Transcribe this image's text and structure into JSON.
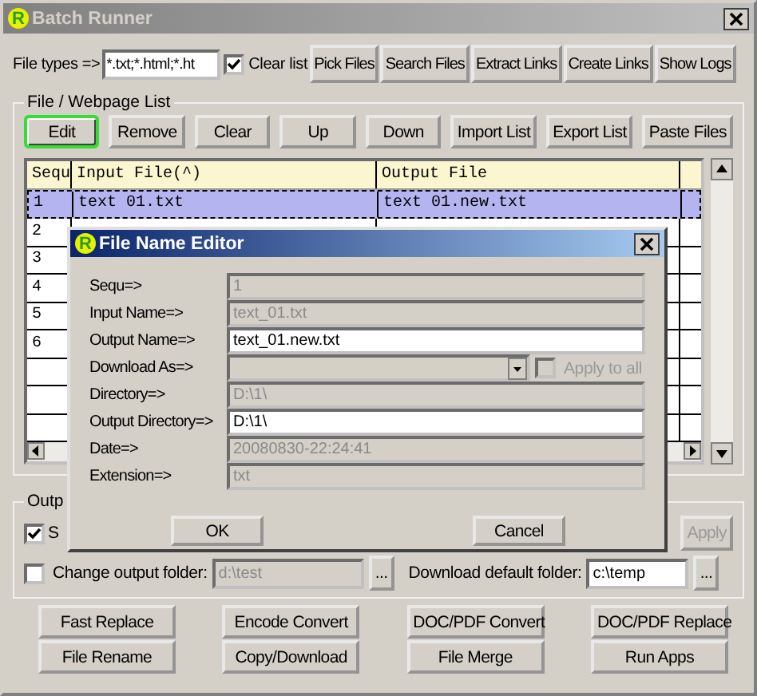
{
  "window": {
    "icon_letter": "R",
    "title": "Batch Runner"
  },
  "top_bar": {
    "file_types_label": "File types =>",
    "file_types_value": "*.txt;*.html;*.ht",
    "clear_list": {
      "label": "Clear list",
      "checked": true
    },
    "buttons": [
      "Pick Files",
      "Search Files",
      "Extract Links",
      "Create Links",
      "Show Logs"
    ]
  },
  "list_group": {
    "title": "File / Webpage List",
    "buttons": [
      {
        "label": "Edit",
        "highlighted": true
      },
      {
        "label": "Remove",
        "highlighted": false
      },
      {
        "label": "Clear",
        "highlighted": false
      },
      {
        "label": "Up",
        "highlighted": false
      },
      {
        "label": "Down",
        "highlighted": false
      },
      {
        "label": "Import List",
        "highlighted": false
      },
      {
        "label": "Export List",
        "highlighted": false
      },
      {
        "label": "Paste Files",
        "highlighted": false
      }
    ],
    "table": {
      "columns": [
        "Sequ",
        "Input File(^)",
        "Output File"
      ],
      "rows": [
        {
          "seq": "1",
          "input": "text 01.txt",
          "output": "text 01.new.txt",
          "selected": true
        },
        {
          "seq": "2",
          "selected": false
        },
        {
          "seq": "3",
          "selected": false
        },
        {
          "seq": "4",
          "selected": false
        },
        {
          "seq": "5",
          "selected": false
        },
        {
          "seq": "6",
          "selected": false
        }
      ]
    }
  },
  "output_group": {
    "title": "Outp",
    "checkbox": {
      "label": "S",
      "checked": true
    },
    "apply_button": {
      "label": "Apply",
      "disabled": true
    },
    "change_folder": {
      "label": "Change output folder:",
      "checked": false,
      "value": "d:\\test",
      "browse": "..."
    },
    "download_folder": {
      "label": "Download default folder:",
      "value": "c:\\temp",
      "browse": "..."
    }
  },
  "action_buttons": [
    "Fast Replace",
    "Encode Convert",
    "DOC/PDF Convert",
    "DOC/PDF Replace",
    "File Rename",
    "Copy/Download",
    "File Merge",
    "Run Apps"
  ],
  "dialog": {
    "icon_letter": "R",
    "title": "File Name Editor",
    "fields": [
      {
        "kind": "text",
        "label": "Sequ=>",
        "value": "1",
        "editable": false
      },
      {
        "kind": "text",
        "label": "Input Name=>",
        "value": "text_01.txt",
        "editable": false
      },
      {
        "kind": "text",
        "label": "Output Name=>",
        "value": "text_01.new.txt",
        "editable": true
      },
      {
        "kind": "dropdown",
        "label": "Download As=>",
        "editable": false,
        "apply_to_all": {
          "label": "Apply to all",
          "checked": false,
          "disabled": true
        }
      },
      {
        "kind": "text",
        "label": "Directory=>",
        "value": "D:\\1\\",
        "editable": false
      },
      {
        "kind": "text",
        "label": "Output Directory=>",
        "value": "D:\\1\\",
        "editable": true
      },
      {
        "kind": "text",
        "label": "Date=>",
        "value": "20080830-22:24:41",
        "editable": false
      },
      {
        "kind": "text",
        "label": "Extension=>",
        "value": "txt",
        "editable": false
      }
    ],
    "buttons": [
      "OK",
      "Cancel"
    ]
  }
}
